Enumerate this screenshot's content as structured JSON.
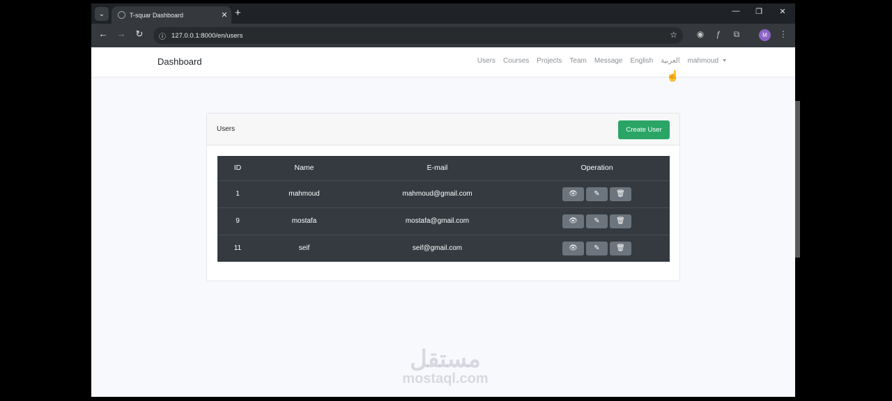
{
  "browser": {
    "tab_title": "T-squar Dashboard",
    "tab_close": "✕",
    "tab_menu": "⌄",
    "new_tab": "+",
    "url": "127.0.0.1:8000/en/users",
    "window_controls": {
      "minimize": "—",
      "restore": "❐",
      "close": "✕"
    },
    "profile_initial": "M"
  },
  "navbar": {
    "brand": "Dashboard",
    "links": [
      "Users",
      "Courses",
      "Projects",
      "Team",
      "Message",
      "English",
      "العربية"
    ],
    "user_menu": "mahmoud"
  },
  "card": {
    "title": "Users",
    "create_button": "Create User"
  },
  "table": {
    "headers": [
      "ID",
      "Name",
      "E-mail",
      "Operation"
    ],
    "rows": [
      {
        "id": "1",
        "name": "mahmoud",
        "email": "mahmoud@gmail.com"
      },
      {
        "id": "9",
        "name": "mostafa",
        "email": "mostafa@gmail.com"
      },
      {
        "id": "11",
        "name": "seif",
        "email": "seif@gmail.com"
      }
    ],
    "operation_icons": [
      "eye-icon",
      "edit-icon",
      "trash-icon"
    ]
  },
  "watermark": {
    "arabic": "مستقل",
    "latin": "mostaql.com"
  }
}
